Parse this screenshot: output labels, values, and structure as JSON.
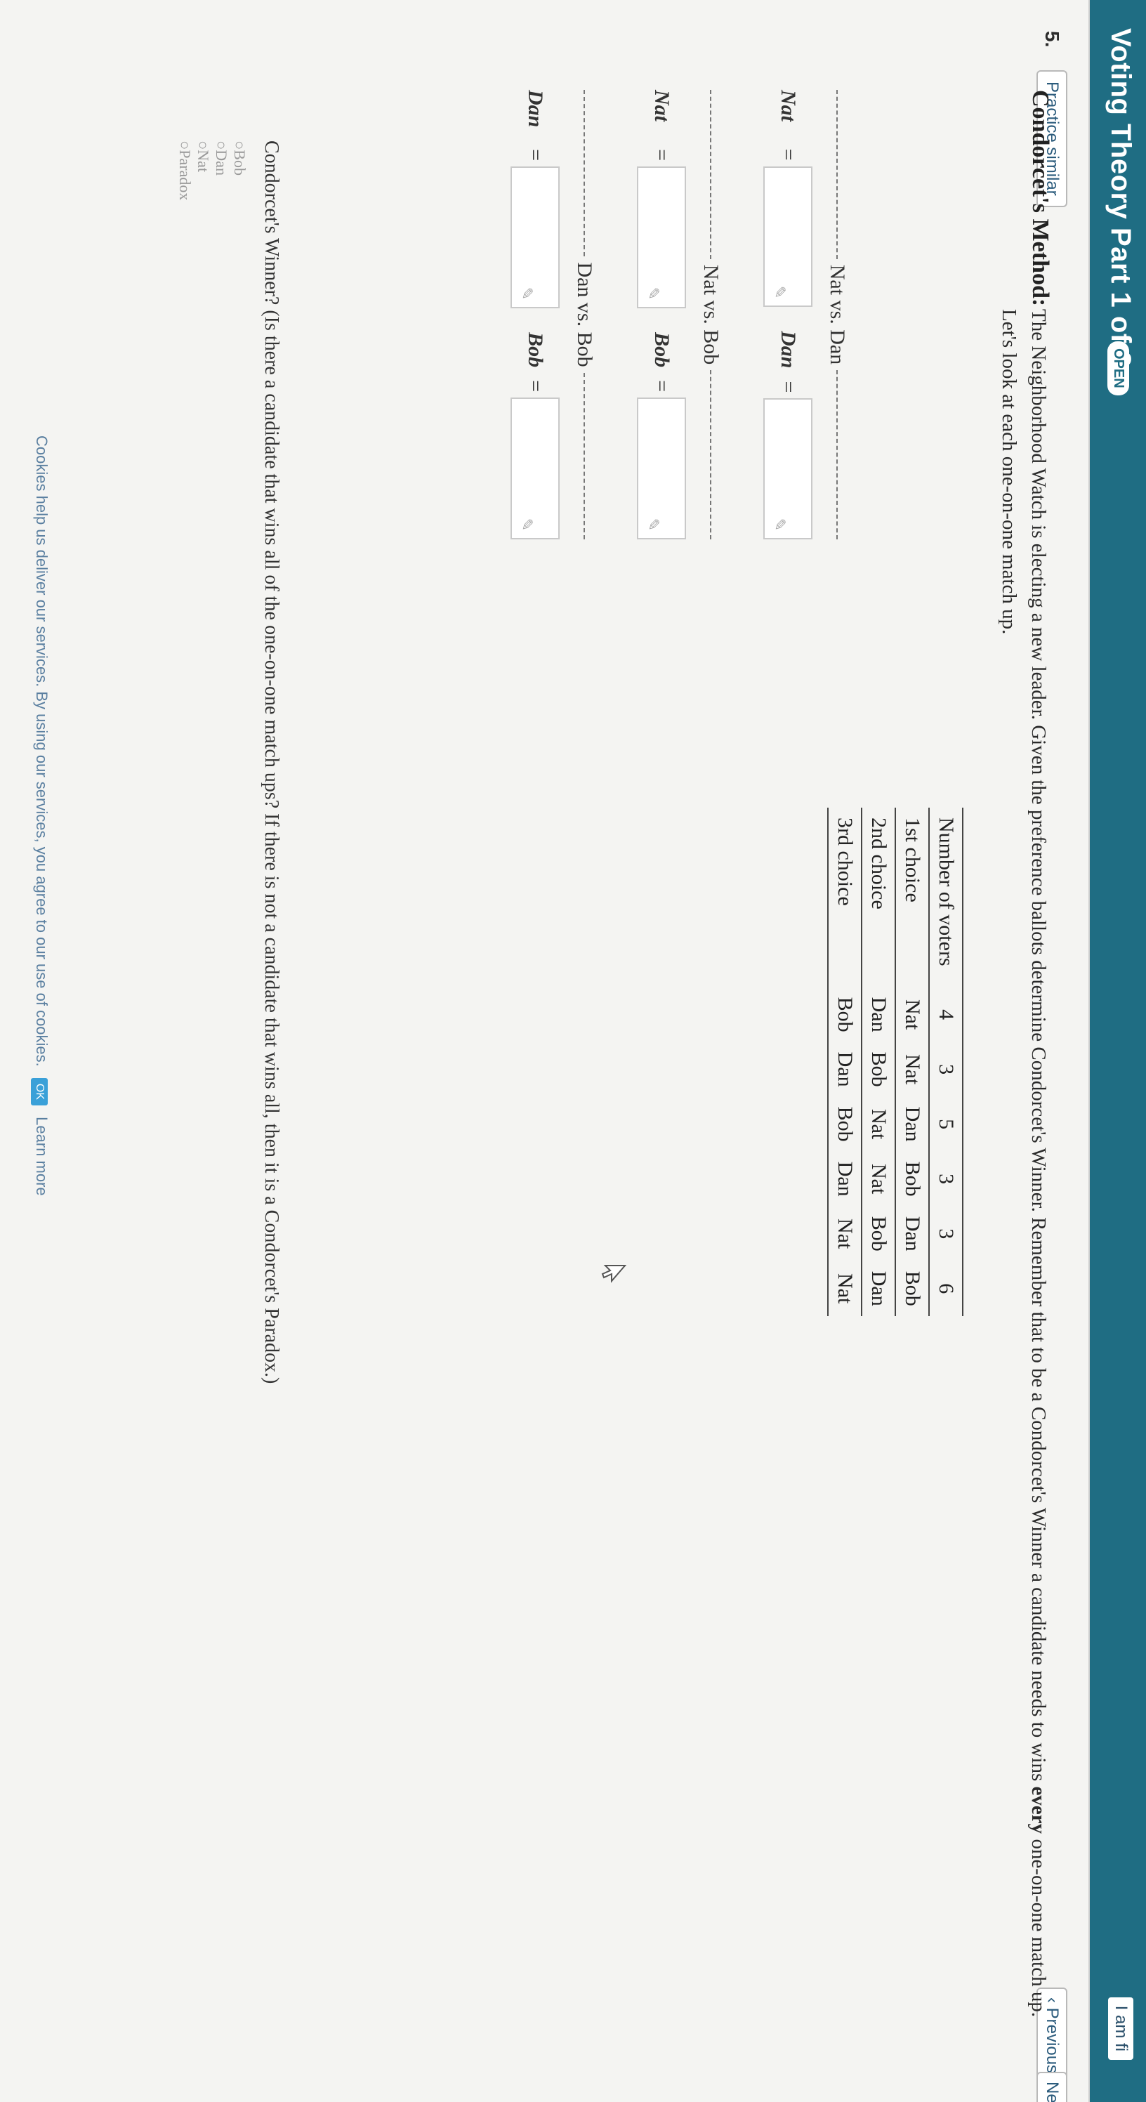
{
  "header": {
    "title": "Voting Theory Part 1 of 2",
    "badge": "OPEN",
    "right_text": "I am fi"
  },
  "question": {
    "number": "5.",
    "practice_label": "Practice similar",
    "prev_label": "‹ Previous",
    "next_label": "Ne"
  },
  "section_title": "Condorcet's Method:",
  "problem": {
    "intro": "The Neighborhood Watch is electing a new leader. Given the preference ballots determine Condorcet's Winner. Remember that to be a Condorcet's Winner a candidate needs to wins ",
    "emph": "every",
    "rest": " one-on-one match up. Let's look at each one-on-one match up."
  },
  "table": {
    "header_label": "Number of voters",
    "counts": [
      "4",
      "3",
      "5",
      "3",
      "3",
      "6"
    ],
    "rows": [
      {
        "label": "1st choice",
        "cells": [
          "Nat",
          "Nat",
          "Dan",
          "Bob",
          "Dan",
          "Bob"
        ]
      },
      {
        "label": "2nd choice",
        "cells": [
          "Dan",
          "Bob",
          "Nat",
          "Nat",
          "Bob",
          "Dan"
        ]
      },
      {
        "label": "3rd choice",
        "cells": [
          "Bob",
          "Dan",
          "Bob",
          "Dan",
          "Nat",
          "Nat"
        ]
      }
    ]
  },
  "matchups": [
    {
      "title": "Nat vs. Dan",
      "a": "Nat",
      "b": "Dan"
    },
    {
      "title": "Nat vs. Bob",
      "a": "Nat",
      "b": "Bob"
    },
    {
      "title": "Dan vs. Bob",
      "a": "Dan",
      "b": "Bob"
    }
  ],
  "winner_question": "Condorcet's Winner? (Is there a candidate that wins all of the one-on-one match ups? If there is not a candidate that wins all, then it is a Condorcet's Paradox.)",
  "choices": [
    "Bob",
    "Dan",
    "Nat",
    "Paradox"
  ],
  "cookie": {
    "text": "Cookies help us deliver our services. By using our services, you agree to our use of cookies.",
    "ok": "OK",
    "learn": "Learn more"
  }
}
